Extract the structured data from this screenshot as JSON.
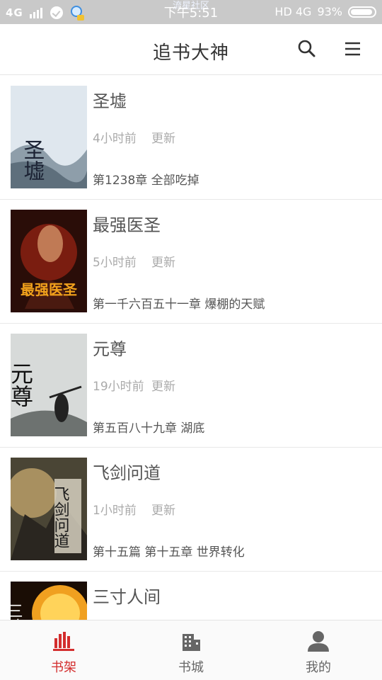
{
  "status_bar": {
    "signal": "4G",
    "overlay_text": "流星社区",
    "time": "下午5:51",
    "network": "HD 4G",
    "battery_text": "93%",
    "battery_level": 0.93
  },
  "header": {
    "title": "追书大神"
  },
  "books": [
    {
      "title": "圣墟",
      "time": "4小时前",
      "update_label": "更新",
      "chapter": "第1238章 全部吃掉",
      "cover_text": "圣墟",
      "cover_bg": "#e8eef3",
      "cover_fg": "#1b2233"
    },
    {
      "title": "最强医圣",
      "time": "5小时前",
      "update_label": "更新",
      "chapter": "第一千六百五十一章 爆棚的天赋",
      "cover_text": "最强医圣",
      "cover_bg": "#3a1410",
      "cover_fg": "#f2a21c"
    },
    {
      "title": "元尊",
      "time": "19小时前",
      "update_label": "更新",
      "chapter": "第五百八十九章 湖底",
      "cover_text": "元尊",
      "cover_bg": "#d9dcdc",
      "cover_fg": "#111111"
    },
    {
      "title": "飞剑问道",
      "time": "1小时前",
      "update_label": "更新",
      "chapter": "第十五篇 第十五章 世界转化",
      "cover_text": "飞剑问道",
      "cover_bg": "#7b6a4a",
      "cover_fg": "#1a1a1a"
    },
    {
      "title": "三寸人间",
      "time": "",
      "update_label": "",
      "chapter": "",
      "cover_text": "三寸",
      "cover_bg": "#1a0d05",
      "cover_fg": "#ffffff"
    }
  ],
  "tabs": [
    {
      "label": "书架",
      "icon": "bookshelf-icon",
      "active": true
    },
    {
      "label": "书城",
      "icon": "bookstore-icon",
      "active": false
    },
    {
      "label": "我的",
      "icon": "profile-icon",
      "active": false
    }
  ],
  "colors": {
    "accent": "#d32d2d",
    "status_bar": "#c9c9c9",
    "icon_gray": "#666666"
  }
}
